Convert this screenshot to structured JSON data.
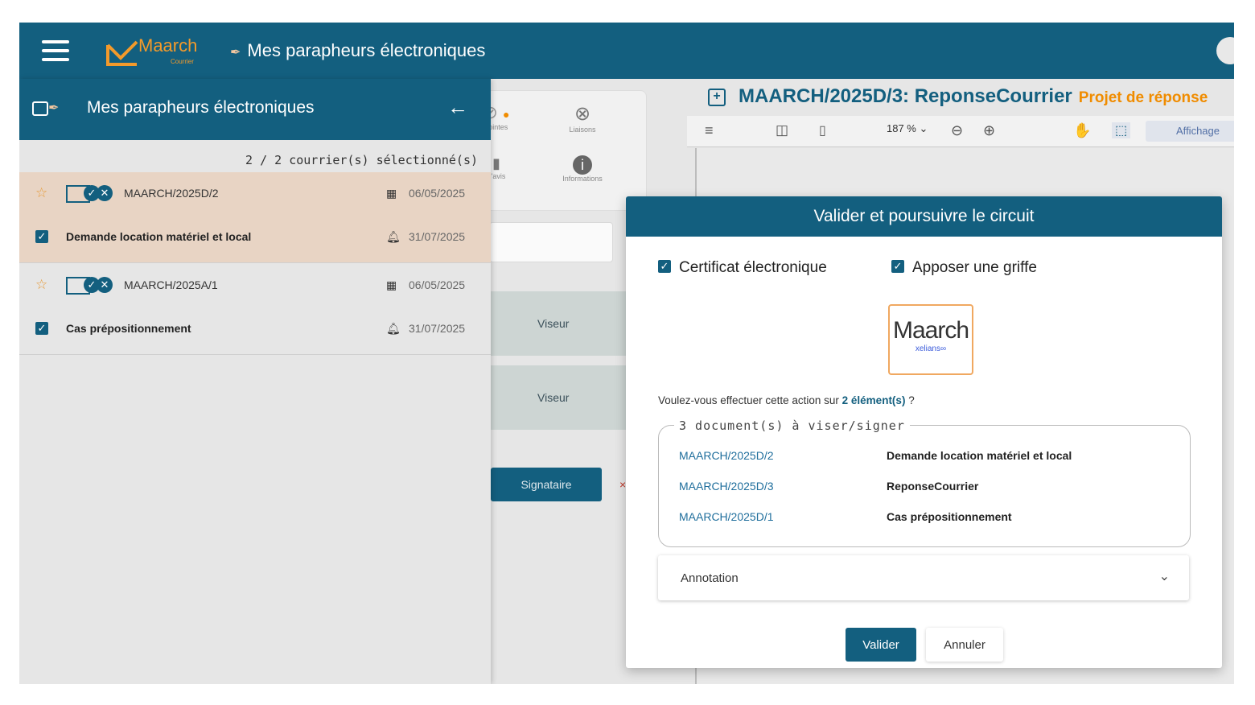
{
  "header": {
    "logo_text": "Maarch",
    "logo_sub": "Courrier",
    "title": "Mes parapheurs électroniques"
  },
  "background": {
    "tabs": [
      {
        "label": "Jointes"
      },
      {
        "label": "Liaisons"
      },
      {
        "label": "d'avis"
      },
      {
        "label": "Informations"
      }
    ],
    "rows": [
      {
        "label": "Viseur"
      },
      {
        "label": "Viseur"
      }
    ],
    "signataire_label": "Signataire",
    "viewer": {
      "title": "MAARCH/2025D/3: ReponseCourrier",
      "status": "Projet de réponse",
      "zoom": "187 %",
      "display_label": "Affichage"
    }
  },
  "sidebar": {
    "title": "Mes parapheurs électroniques",
    "count": "2 / 2 courrier(s) sélectionné(s)",
    "items": [
      {
        "ref": "MAARCH/2025D/2",
        "date": "06/05/2025",
        "subject": "Demande location matériel et local",
        "deadline": "31/07/2025",
        "selected": true
      },
      {
        "ref": "MAARCH/2025A/1",
        "date": "06/05/2025",
        "subject": "Cas prépositionnement",
        "deadline": "31/07/2025",
        "selected": false
      }
    ]
  },
  "modal": {
    "title": "Valider et poursuivre le circuit",
    "options": [
      {
        "label": "Certificat électronique",
        "checked": true
      },
      {
        "label": "Apposer une griffe",
        "checked": true
      }
    ],
    "griffe": {
      "main": "Maarch",
      "sub": "xelians"
    },
    "question_prefix": "Voulez-vous effectuer cette action sur",
    "question_count": "2 élément(s)",
    "question_suffix": "?",
    "documents_legend": "3 document(s) à viser/signer",
    "documents": [
      {
        "ref": "MAARCH/2025D/2",
        "subject": "Demande location matériel et local"
      },
      {
        "ref": "MAARCH/2025D/3",
        "subject": "ReponseCourrier"
      },
      {
        "ref": "MAARCH/2025D/1",
        "subject": "Cas prépositionnement"
      }
    ],
    "annotation_label": "Annotation",
    "validate_label": "Valider",
    "cancel_label": "Annuler"
  },
  "colors": {
    "primary": "#135f7f",
    "accent": "#f39a2b",
    "selected_row": "#e8d4c4",
    "status_orange": "#f08c00"
  }
}
